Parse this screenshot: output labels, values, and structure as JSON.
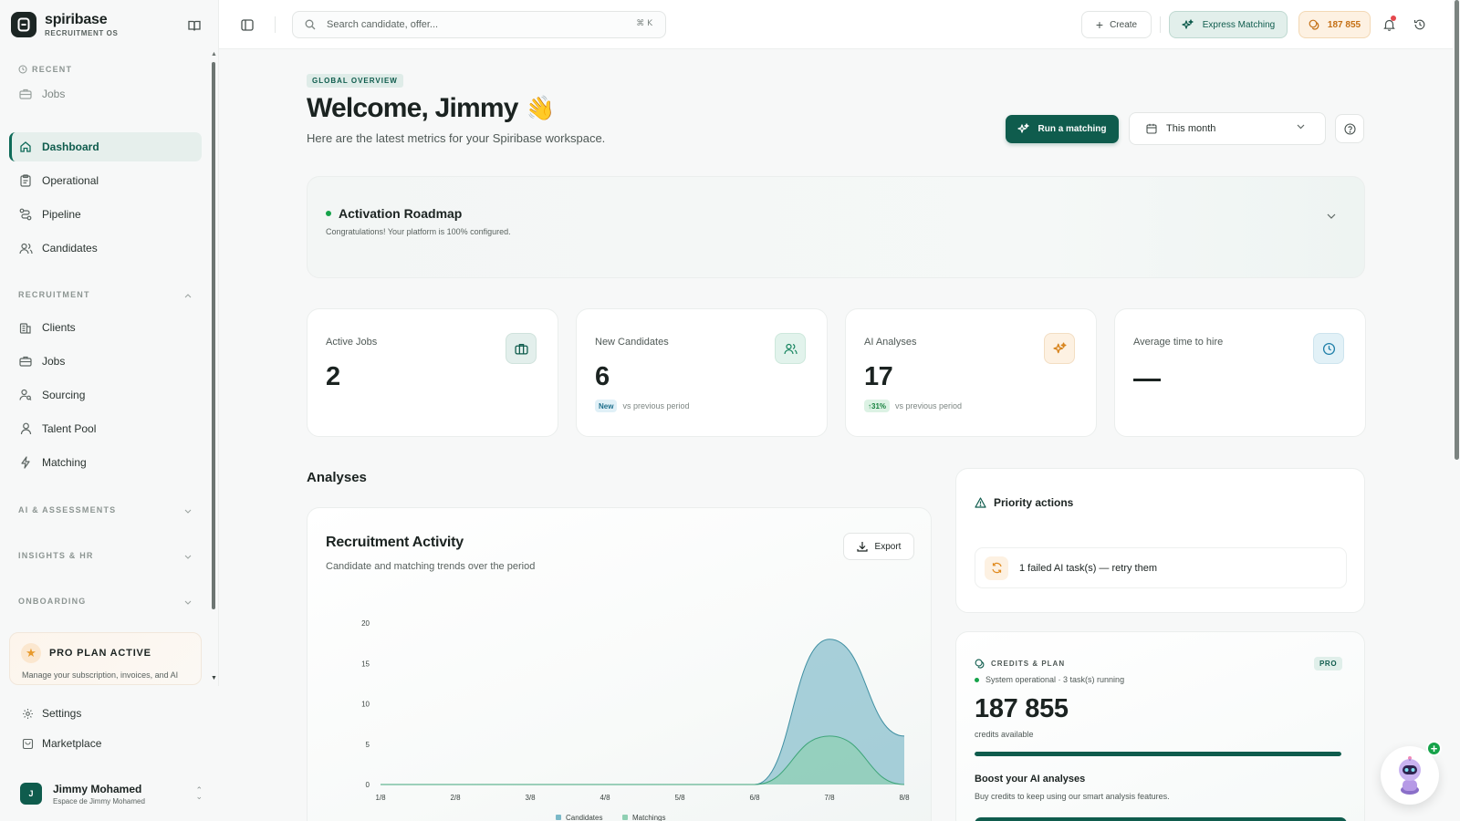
{
  "brand": {
    "name": "spiribase",
    "subtitle": "RECRUITMENT OS"
  },
  "sidebar": {
    "recent_label": "RECENT",
    "recent_items": [
      {
        "label": "Jobs",
        "icon": "briefcase-icon"
      }
    ],
    "main_items": [
      {
        "label": "Dashboard",
        "icon": "home-icon",
        "active": true
      },
      {
        "label": "Operational",
        "icon": "clipboard-icon"
      },
      {
        "label": "Pipeline",
        "icon": "route-icon"
      },
      {
        "label": "Candidates",
        "icon": "users-icon"
      }
    ],
    "recruitment_label": "RECRUITMENT",
    "recruitment_items": [
      {
        "label": "Clients",
        "icon": "building-icon"
      },
      {
        "label": "Jobs",
        "icon": "briefcase-icon"
      },
      {
        "label": "Sourcing",
        "icon": "user-search-icon"
      },
      {
        "label": "Talent Pool",
        "icon": "user-icon"
      },
      {
        "label": "Matching",
        "icon": "bolt-icon"
      }
    ],
    "ai_label": "AI & ASSESSMENTS",
    "insights_label": "INSIGHTS & HR",
    "onboarding_label": "ONBOARDING",
    "pro_card": {
      "title": "PRO PLAN ACTIVE",
      "description": "Manage your subscription, invoices, and AI"
    },
    "bottom_items": [
      {
        "label": "Settings",
        "icon": "gear-icon"
      },
      {
        "label": "Marketplace",
        "icon": "store-icon"
      }
    ],
    "user": {
      "initial": "J",
      "name": "Jimmy Mohamed",
      "workspace": "Espace de Jimmy Mohamed"
    }
  },
  "topbar": {
    "search_placeholder": "Search candidate, offer...",
    "shortcut": "⌘ K",
    "create_label": "Create",
    "express_label": "Express Matching",
    "credits_label": "187 855"
  },
  "header": {
    "tag": "GLOBAL OVERVIEW",
    "welcome": "Welcome, Jimmy",
    "wave": "👋",
    "subtitle": "Here are the latest metrics for your Spiribase workspace.",
    "run_label": "Run a matching",
    "period_label": "This month"
  },
  "roadmap": {
    "title": "Activation Roadmap",
    "subtitle": "Congratulations! Your platform is 100% configured."
  },
  "stats": [
    {
      "label": "Active Jobs",
      "value": "2",
      "icon": "briefcase-icon"
    },
    {
      "label": "New Candidates",
      "value": "6",
      "icon": "users-icon",
      "badge": "New",
      "foot": "vs previous period"
    },
    {
      "label": "AI Analyses",
      "value": "17",
      "icon": "sparkles-icon",
      "badge": "↑31%",
      "foot": "vs previous period"
    },
    {
      "label": "Average time to hire",
      "value": "—",
      "icon": "clock-icon"
    }
  ],
  "analyses_heading": "Analyses",
  "activity": {
    "title": "Recruitment Activity",
    "subtitle": "Candidate and matching trends over the period",
    "export_label": "Export"
  },
  "chart_data": {
    "type": "area",
    "x": [
      "1/8",
      "2/8",
      "3/8",
      "4/8",
      "5/8",
      "6/8",
      "7/8",
      "8/8"
    ],
    "series": [
      {
        "name": "Candidates",
        "values": [
          0,
          0,
          0,
          0,
          0,
          0,
          18,
          6
        ],
        "color": "#7bb9c8"
      },
      {
        "name": "Matchings",
        "values": [
          0,
          0,
          0,
          0,
          0,
          0,
          6,
          0
        ],
        "color": "#8fd0b3"
      }
    ],
    "y_ticks": [
      0,
      5,
      10,
      15,
      20
    ],
    "ylim": [
      0,
      20
    ],
    "legend": "bottom"
  },
  "priority": {
    "title": "Priority actions",
    "item": "1 failed AI task(s) — retry them"
  },
  "credits": {
    "label": "CREDITS & PLAN",
    "plan": "PRO",
    "status": "System operational · 3 task(s) running",
    "value": "187 855",
    "available": "credits available",
    "usage_fraction": 1.0,
    "boost_title": "Boost your AI analyses",
    "boost_sub": "Buy credits to keep using our smart analysis features."
  },
  "colors": {
    "accent": "#0f5c4d",
    "credits": "#c46f14",
    "success": "#16a34a"
  }
}
